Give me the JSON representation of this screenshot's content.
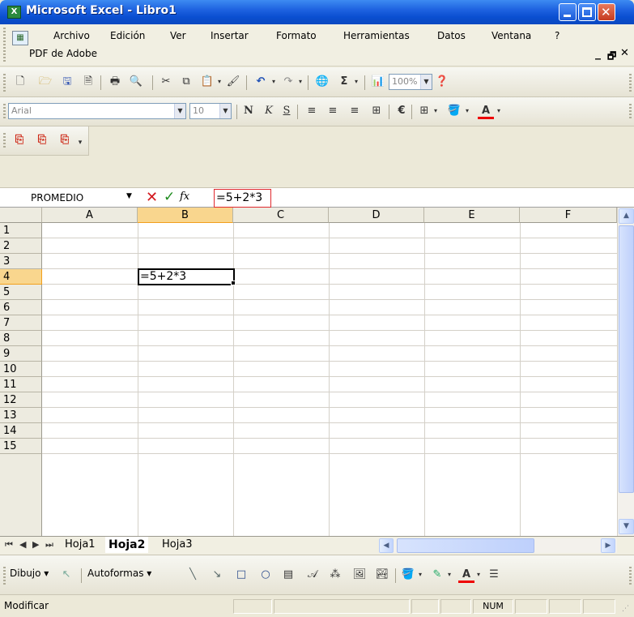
{
  "window": {
    "title": "Microsoft Excel - Libro1",
    "app_icon": "excel-icon"
  },
  "menu": {
    "items": [
      "Archivo",
      "Edición",
      "Ver",
      "Insertar",
      "Formato",
      "Herramientas",
      "Datos",
      "Ventana",
      "?"
    ],
    "second_row": "PDF de Adobe"
  },
  "toolbar_standard": {
    "zoom": "100%"
  },
  "toolbar_format": {
    "font": "Arial",
    "size": "10",
    "bold": "N",
    "italic": "K",
    "underline": "S",
    "euro": "€"
  },
  "formula_bar": {
    "name_box": "PROMEDIO",
    "fx": "fx",
    "formula": "=5+2*3"
  },
  "grid": {
    "columns": [
      "A",
      "B",
      "C",
      "D",
      "E",
      "F"
    ],
    "rows": [
      "1",
      "2",
      "3",
      "4",
      "5",
      "6",
      "7",
      "8",
      "9",
      "10",
      "11",
      "12",
      "13",
      "14",
      "15"
    ],
    "active_cell": {
      "ref": "B4",
      "value": "=5+2*3"
    }
  },
  "sheets": {
    "tabs": [
      "Hoja1",
      "Hoja2",
      "Hoja3"
    ],
    "active": "Hoja2"
  },
  "drawing_toolbar": {
    "draw": "Dibujo",
    "autoshapes": "Autoformas"
  },
  "status_bar": {
    "mode": "Modificar",
    "num": "NUM"
  }
}
